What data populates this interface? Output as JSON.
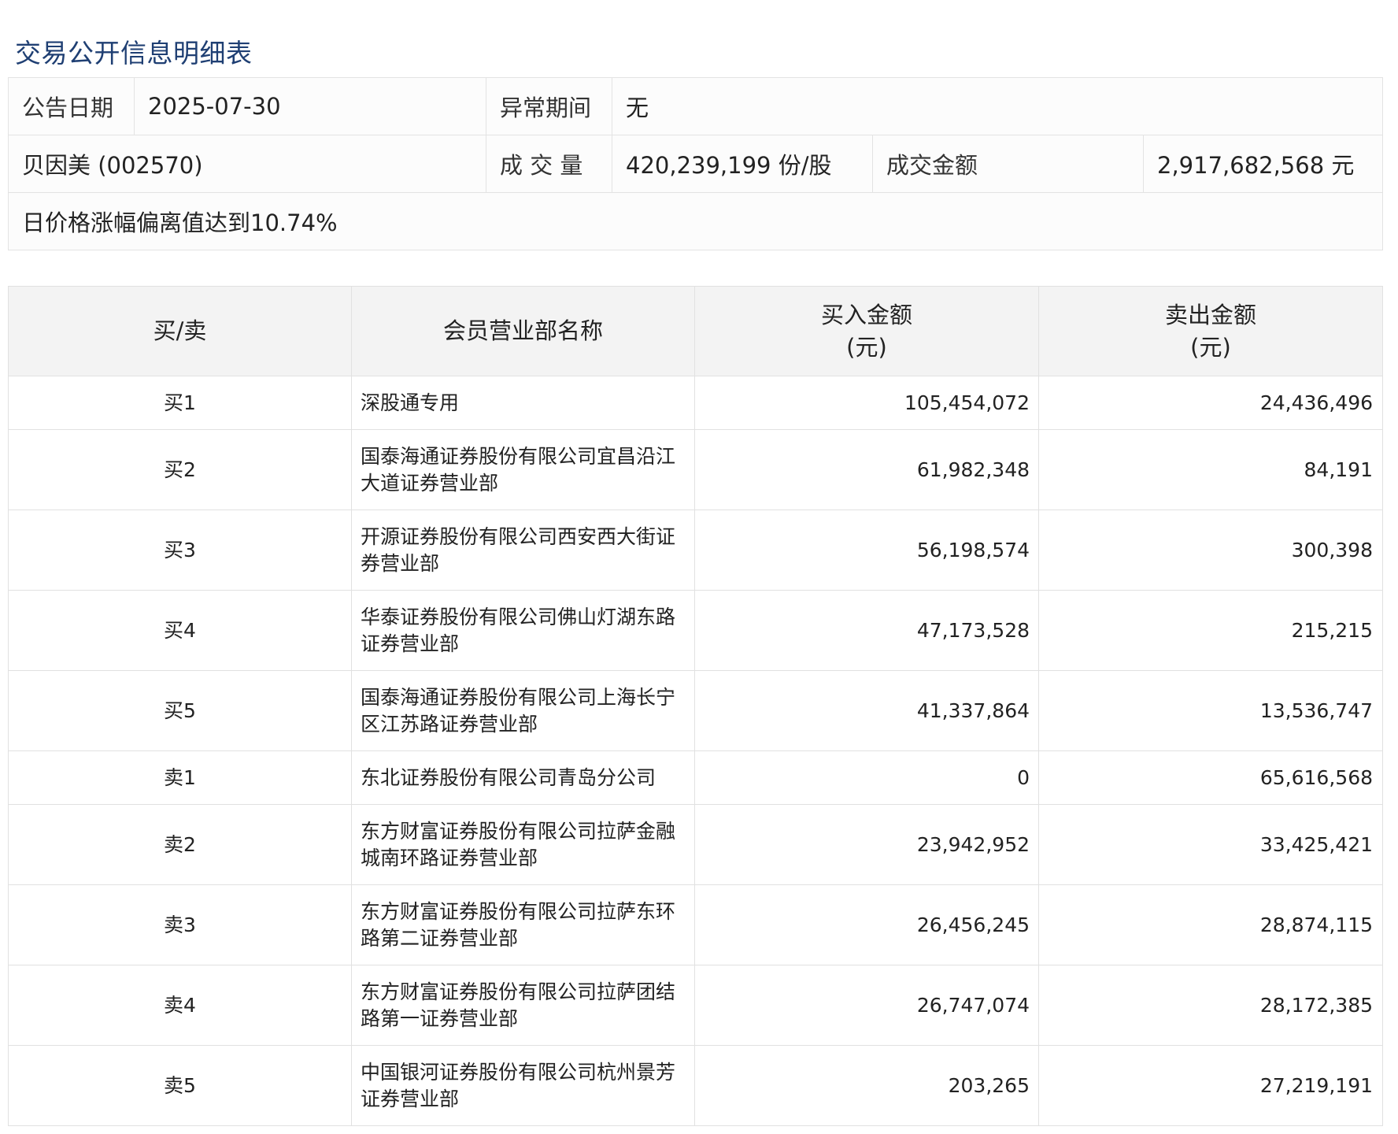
{
  "page_title": "交易公开信息明细表",
  "summary": {
    "date_label": "公告日期",
    "date_value": "2025-07-30",
    "period_label": "异常期间",
    "period_value": "无",
    "stock": "贝因美 (002570)",
    "volume_label": "成 交 量",
    "volume_value": "420,239,199 份/股",
    "amount_label": "成交金额",
    "amount_value": "2,917,682,568 元",
    "reason": "日价格涨幅偏离值达到10.74%"
  },
  "detail": {
    "headers": {
      "side": "买/卖",
      "name": "会员营业部名称",
      "buy_line1": "买入金额",
      "buy_line2": "(元)",
      "sell_line1": "卖出金额",
      "sell_line2": "(元)"
    },
    "rows": [
      {
        "side": "买1",
        "name": "深股通专用",
        "buy": "105,454,072",
        "sell": "24,436,496"
      },
      {
        "side": "买2",
        "name": "国泰海通证券股份有限公司宜昌沿江大道证券营业部",
        "buy": "61,982,348",
        "sell": "84,191"
      },
      {
        "side": "买3",
        "name": "开源证券股份有限公司西安西大街证券营业部",
        "buy": "56,198,574",
        "sell": "300,398"
      },
      {
        "side": "买4",
        "name": "华泰证券股份有限公司佛山灯湖东路证券营业部",
        "buy": "47,173,528",
        "sell": "215,215"
      },
      {
        "side": "买5",
        "name": "国泰海通证券股份有限公司上海长宁区江苏路证券营业部",
        "buy": "41,337,864",
        "sell": "13,536,747"
      },
      {
        "side": "卖1",
        "name": "东北证券股份有限公司青岛分公司",
        "buy": "0",
        "sell": "65,616,568"
      },
      {
        "side": "卖2",
        "name": "东方财富证券股份有限公司拉萨金融城南环路证券营业部",
        "buy": "23,942,952",
        "sell": "33,425,421"
      },
      {
        "side": "卖3",
        "name": "东方财富证券股份有限公司拉萨东环路第二证券营业部",
        "buy": "26,456,245",
        "sell": "28,874,115"
      },
      {
        "side": "卖4",
        "name": "东方财富证券股份有限公司拉萨团结路第一证券营业部",
        "buy": "26,747,074",
        "sell": "28,172,385"
      },
      {
        "side": "卖5",
        "name": "中国银河证券股份有限公司杭州景芳证券营业部",
        "buy": "203,265",
        "sell": "27,219,191"
      }
    ]
  }
}
